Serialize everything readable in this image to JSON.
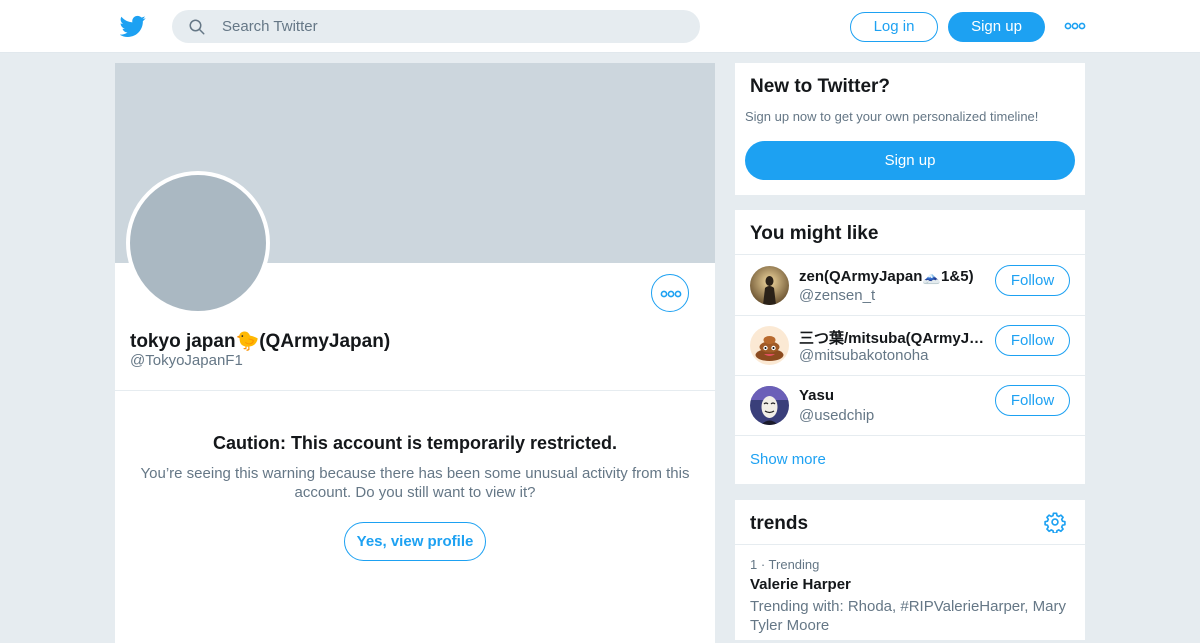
{
  "header": {
    "search_placeholder": "Search Twitter",
    "login_label": "Log in",
    "signup_label": "Sign up"
  },
  "profile": {
    "name": "tokyo japan🐤(QArmyJapan)",
    "handle": "@TokyoJapanF1",
    "warning_title": "Caution: This account is temporarily restricted.",
    "warning_body": "You’re seeing this warning because there has been some unusual activity from this account. Do you still want to view it?",
    "view_button": "Yes, view profile"
  },
  "new_to_twitter": {
    "title": "New to Twitter?",
    "subtitle": "Sign up now to get your own personalized timeline!",
    "signup_label": "Sign up"
  },
  "you_might_like": {
    "title": "You might like",
    "items": [
      {
        "name": "zen(QArmyJapan🗻1&5)",
        "handle": "@zensen_t",
        "follow_label": "Follow"
      },
      {
        "name": "三つ葉/mitsuba(QArmyJa...",
        "handle": "@mitsubakotonoha",
        "follow_label": "Follow"
      },
      {
        "name": "Yasu",
        "handle": "@usedchip",
        "follow_label": "Follow"
      }
    ],
    "show_more": "Show more"
  },
  "trends": {
    "title": "trends",
    "items": [
      {
        "meta": "1 · Trending",
        "name": "Valerie Harper",
        "with": "Trending with: Rhoda, #RIPValerieHarper, Mary Tyler Moore"
      }
    ]
  },
  "colors": {
    "accent": "#1da1f2",
    "page_bg": "#e6ecf0",
    "banner": "#ccd6dd",
    "avatar_placeholder": "#aab8c2",
    "muted_text": "#657786"
  },
  "icons": [
    "twitter-bird-icon",
    "search-icon",
    "more-dots-icon",
    "gear-icon"
  ]
}
